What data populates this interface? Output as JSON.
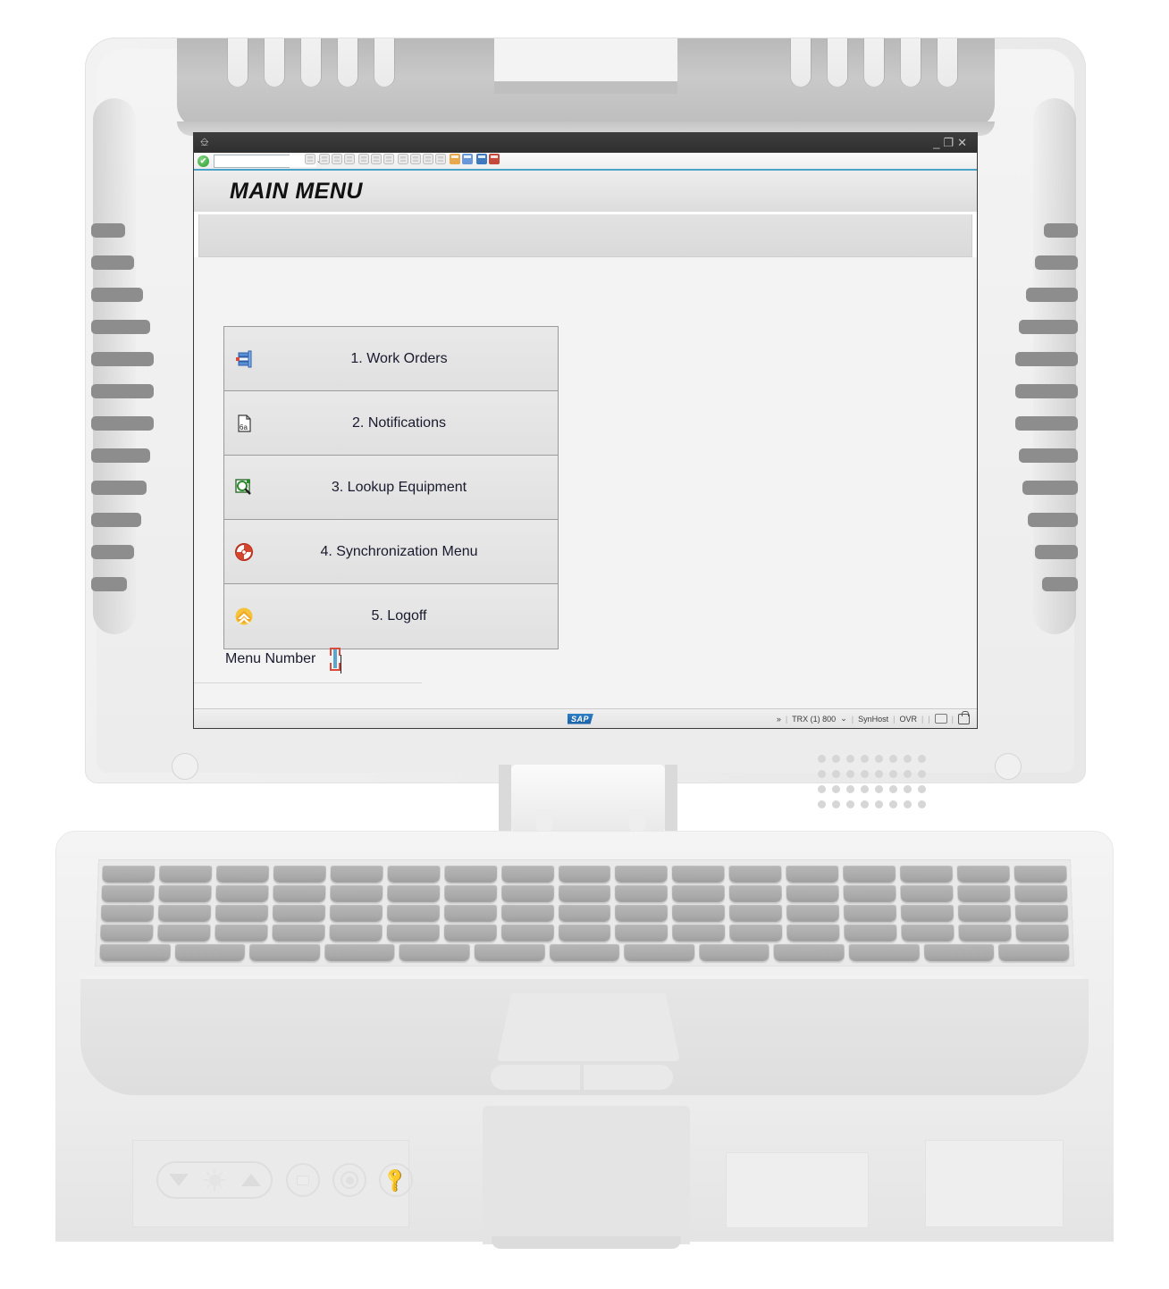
{
  "window": {
    "titlebar_icon": "window-menu-icon",
    "minimize": "_",
    "maximize": "❐",
    "close": "✕"
  },
  "toolbar": {
    "ok_badge": "✔",
    "command_value": "",
    "command_placeholder": "",
    "dropdown_arrow": "⌄",
    "back_chevron": "«",
    "icons": [
      "save-icon",
      "back-icon",
      "exit-icon",
      "cancel-icon",
      "print-icon",
      "find-icon",
      "find-next-icon",
      "first-page-icon",
      "previous-page-icon",
      "next-page-icon",
      "last-page-icon",
      "create-session-icon",
      "create-shortcut-icon",
      "help-icon",
      "customize-layout-icon"
    ]
  },
  "screen": {
    "title": "MAIN MENU"
  },
  "menu": {
    "items": [
      {
        "label": "1. Work Orders",
        "icon": "work-order-icon"
      },
      {
        "label": "2. Notifications",
        "icon": "notification-document-icon"
      },
      {
        "label": "3. Lookup Equipment",
        "icon": "lookup-equipment-icon"
      },
      {
        "label": "4. Synchronization Menu",
        "icon": "synchronization-icon"
      },
      {
        "label": "5. Logoff",
        "icon": "logoff-icon"
      }
    ]
  },
  "form": {
    "menu_number_label": "Menu Number",
    "menu_number_value": "",
    "menu_number_placeholder": ""
  },
  "statusbar": {
    "logo": "SAP",
    "expand": "»",
    "system": "TRX (1) 800",
    "system_arrow": "⌄",
    "host": "SynHost",
    "insert_mode": "OVR",
    "separator": "|",
    "keyboard_icon": "keyboard-status-icon",
    "lock_icon": "session-lock-icon"
  },
  "hardware": {
    "brightness_down": "brightness-down-icon",
    "brightness_sun": "brightness-icon",
    "brightness_up": "brightness-up-icon",
    "keyboard_light_button": "keyboard-backlight-icon",
    "power_button": "power-icon",
    "key_button": "key-icon",
    "speaker_grille": "speaker-grille",
    "touchpad": "touchpad",
    "touchpad_left_button": "touchpad-left-button",
    "touchpad_right_button": "touchpad-right-button"
  },
  "colors": {
    "accent": "#4aa3c7",
    "focus_border": "#5aa6cc",
    "focus_corner": "#d94b3d",
    "sap_blue": "#1e6fb8",
    "ok_green": "#2e9e2e"
  }
}
